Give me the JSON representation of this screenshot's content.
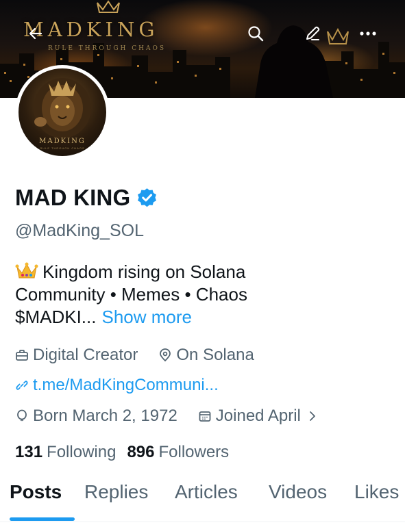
{
  "banner": {
    "title": "MADKING",
    "tagline": "RULE THROUGH CHAOS"
  },
  "toolbar": {
    "back": "arrow-left-icon",
    "search": "search-icon",
    "edit": "pencil-icon",
    "more": "more-horizontal-icon"
  },
  "avatar": {
    "label": "MADKING",
    "sub": "RULE THROUGH CHAOS"
  },
  "profile": {
    "display_name": "MAD KING",
    "verified_icon": "verified-badge-icon",
    "handle": "@MadKing_SOL",
    "bio_line1": "Kingdom rising on Solana",
    "bio_line2": "Community • Memes • Chaos",
    "bio_line3": "$MADKI...",
    "show_more": "Show more",
    "category": "Digital Creator",
    "location": "On Solana",
    "website": "t.me/MadKingCommuni...",
    "birthday": "Born March 2, 1972",
    "joined": "Joined April",
    "following_count": "131",
    "following_label": "Following",
    "followers_count": "896",
    "followers_label": "Followers"
  },
  "tabs": [
    {
      "label": "Posts",
      "active": true
    },
    {
      "label": "Replies"
    },
    {
      "label": "Articles"
    },
    {
      "label": "Videos"
    },
    {
      "label": "Likes"
    }
  ],
  "colors": {
    "accent": "#1d9bf0",
    "text": "#0f1419",
    "secondary": "#536471",
    "banner_gold": "#c9a35a"
  }
}
